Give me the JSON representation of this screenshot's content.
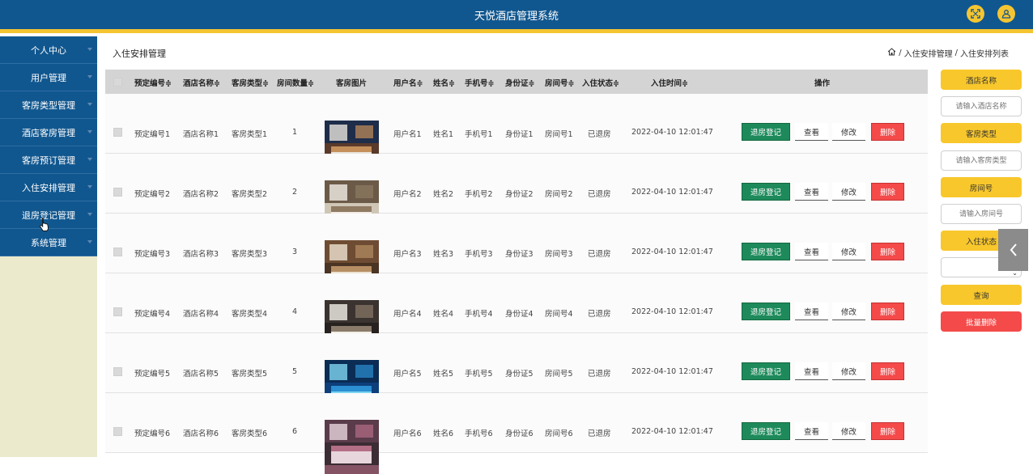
{
  "app": {
    "title": "天悦酒店管理系统"
  },
  "header": {
    "fullscreen_icon": "fullscreen-icon",
    "user_icon": "user-icon"
  },
  "sidebar": {
    "items": [
      {
        "label": "个人中心"
      },
      {
        "label": "用户管理"
      },
      {
        "label": "客房类型管理"
      },
      {
        "label": "酒店客房管理"
      },
      {
        "label": "客房预订管理"
      },
      {
        "label": "入住安排管理"
      },
      {
        "label": "退房登记管理"
      },
      {
        "label": "系统管理"
      }
    ]
  },
  "page": {
    "title": "入住安排管理",
    "breadcrumb": {
      "home_icon": "home-icon",
      "parts": [
        "入住安排管理",
        "入住安排列表"
      ],
      "separator": "/"
    }
  },
  "table": {
    "headers": {
      "booking_no": "预定编号",
      "hotel_name": "酒店名称",
      "room_type": "客房类型",
      "room_count": "房间数量",
      "room_image": "客房图片",
      "username": "用户名",
      "name": "姓名",
      "phone": "手机号",
      "id_card": "身份证",
      "room_no": "房间号",
      "status": "入住状态",
      "checkin_time": "入住时间",
      "actions": "操作"
    },
    "sort_marker": "≑",
    "actions": {
      "checkout": "退房登记",
      "view": "查看",
      "edit": "修改",
      "delete": "删除"
    },
    "rows": [
      {
        "booking_no": "预定编号1",
        "hotel_name": "酒店名称1",
        "room_type": "客房类型1",
        "room_count": "1",
        "username": "用户名1",
        "name": "姓名1",
        "phone": "手机号1",
        "id_card": "身份证1",
        "room_no": "房间号1",
        "status": "已退房",
        "checkin_time": "2022-04-10 12:01:47"
      },
      {
        "booking_no": "预定编号2",
        "hotel_name": "酒店名称2",
        "room_type": "客房类型2",
        "room_count": "2",
        "username": "用户名2",
        "name": "姓名2",
        "phone": "手机号2",
        "id_card": "身份证2",
        "room_no": "房间号2",
        "status": "已退房",
        "checkin_time": "2022-04-10 12:01:47"
      },
      {
        "booking_no": "预定编号3",
        "hotel_name": "酒店名称3",
        "room_type": "客房类型3",
        "room_count": "3",
        "username": "用户名3",
        "name": "姓名3",
        "phone": "手机号3",
        "id_card": "身份证3",
        "room_no": "房间号3",
        "status": "已退房",
        "checkin_time": "2022-04-10 12:01:47"
      },
      {
        "booking_no": "预定编号4",
        "hotel_name": "酒店名称4",
        "room_type": "客房类型4",
        "room_count": "4",
        "username": "用户名4",
        "name": "姓名4",
        "phone": "手机号4",
        "id_card": "身份证4",
        "room_no": "房间号4",
        "status": "已退房",
        "checkin_time": "2022-04-10 12:01:47"
      },
      {
        "booking_no": "预定编号5",
        "hotel_name": "酒店名称5",
        "room_type": "客房类型5",
        "room_count": "5",
        "username": "用户名5",
        "name": "姓名5",
        "phone": "手机号5",
        "id_card": "身份证5",
        "room_no": "房间号5",
        "status": "已退房",
        "checkin_time": "2022-04-10 12:01:47"
      },
      {
        "booking_no": "预定编号6",
        "hotel_name": "酒店名称6",
        "room_type": "客房类型6",
        "room_count": "6",
        "username": "用户名6",
        "name": "姓名6",
        "phone": "手机号6",
        "id_card": "身份证6",
        "room_no": "房间号6",
        "status": "已退房",
        "checkin_time": "2022-04-10 12:01:47"
      }
    ]
  },
  "filters": {
    "hotel_name_label": "酒店名称",
    "hotel_name_placeholder": "请输入酒店名称",
    "room_type_label": "客房类型",
    "room_type_placeholder": "请输入客房类型",
    "room_no_label": "房间号",
    "room_no_placeholder": "请输入房间号",
    "status_label": "入住状态",
    "status_value": "",
    "search_button": "查询",
    "batch_delete_button": "批量删除"
  },
  "colors": {
    "header_blue": "#11578f",
    "accent_yellow": "#f5c531",
    "sidebar_bg": "#ebeacc",
    "checkout_green": "#1e8a5b",
    "delete_red": "#f44a4a"
  }
}
